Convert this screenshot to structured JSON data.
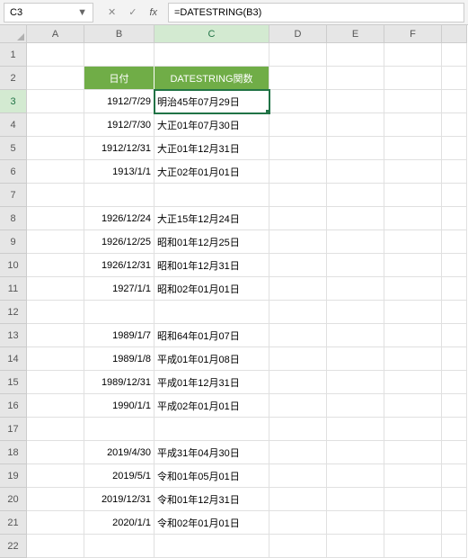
{
  "name_box": "C3",
  "formula": "=DATESTRING(B3)",
  "col_labels": [
    "A",
    "B",
    "C",
    "D",
    "E",
    "F"
  ],
  "row_labels": [
    "1",
    "2",
    "3",
    "4",
    "5",
    "6",
    "7",
    "8",
    "9",
    "10",
    "11",
    "12",
    "13",
    "14",
    "15",
    "16",
    "17",
    "18",
    "19",
    "20",
    "21",
    "22"
  ],
  "header_row": {
    "b": "日付",
    "c": "DATESTRING関数"
  },
  "rows": {
    "3": {
      "b": "1912/7/29",
      "c": "明治45年07月29日"
    },
    "4": {
      "b": "1912/7/30",
      "c": "大正01年07月30日"
    },
    "5": {
      "b": "1912/12/31",
      "c": "大正01年12月31日"
    },
    "6": {
      "b": "1913/1/1",
      "c": "大正02年01月01日"
    },
    "8": {
      "b": "1926/12/24",
      "c": "大正15年12月24日"
    },
    "9": {
      "b": "1926/12/25",
      "c": "昭和01年12月25日"
    },
    "10": {
      "b": "1926/12/31",
      "c": "昭和01年12月31日"
    },
    "11": {
      "b": "1927/1/1",
      "c": "昭和02年01月01日"
    },
    "13": {
      "b": "1989/1/7",
      "c": "昭和64年01月07日"
    },
    "14": {
      "b": "1989/1/8",
      "c": "平成01年01月08日"
    },
    "15": {
      "b": "1989/12/31",
      "c": "平成01年12月31日"
    },
    "16": {
      "b": "1990/1/1",
      "c": "平成02年01月01日"
    },
    "18": {
      "b": "2019/4/30",
      "c": "平成31年04月30日"
    },
    "19": {
      "b": "2019/5/1",
      "c": "令和01年05月01日"
    },
    "20": {
      "b": "2019/12/31",
      "c": "令和01年12月31日"
    },
    "21": {
      "b": "2020/1/1",
      "c": "令和02年01月01日"
    }
  },
  "active_cell": {
    "row": 3,
    "col": "C"
  }
}
